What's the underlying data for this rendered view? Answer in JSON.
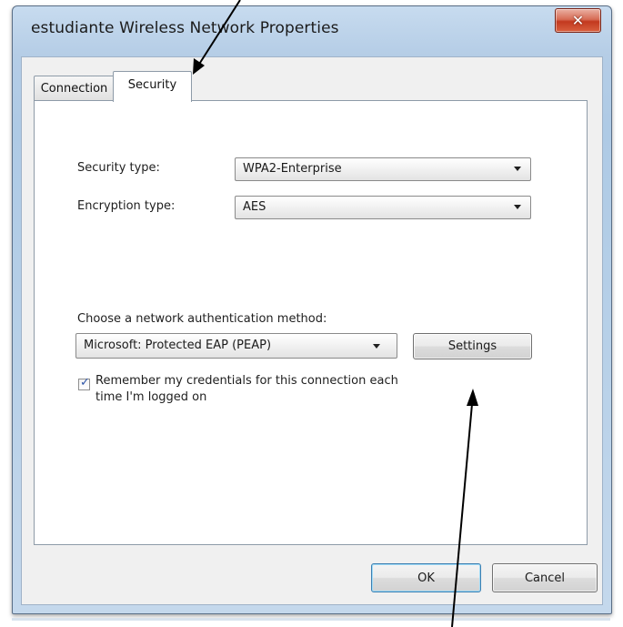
{
  "window": {
    "title": "estudiante Wireless Network Properties",
    "close_glyph": "✕"
  },
  "tabs": [
    {
      "label": "Connection",
      "selected": false
    },
    {
      "label": "Security",
      "selected": true
    }
  ],
  "security": {
    "security_type_label": "Security type:",
    "security_type_value": "WPA2-Enterprise",
    "encryption_type_label": "Encryption type:",
    "encryption_type_value": "AES",
    "auth_method_label": "Choose a network authentication method:",
    "auth_method_value": "Microsoft: Protected EAP (PEAP)",
    "settings_button": "Settings",
    "remember_checked": true,
    "remember_line1": "Remember my credentials for this connection each",
    "remember_line2": "time I'm logged on"
  },
  "footer": {
    "ok_button": "OK",
    "cancel_button": "Cancel"
  },
  "colors": {
    "title_bar": "#b5cde6",
    "close_button": "#c3391f",
    "annotation_arrow": "#000000"
  },
  "icons": {
    "close": "close-icon",
    "dropdown": "chevron-down-icon",
    "checkbox": "checkmark-icon"
  }
}
